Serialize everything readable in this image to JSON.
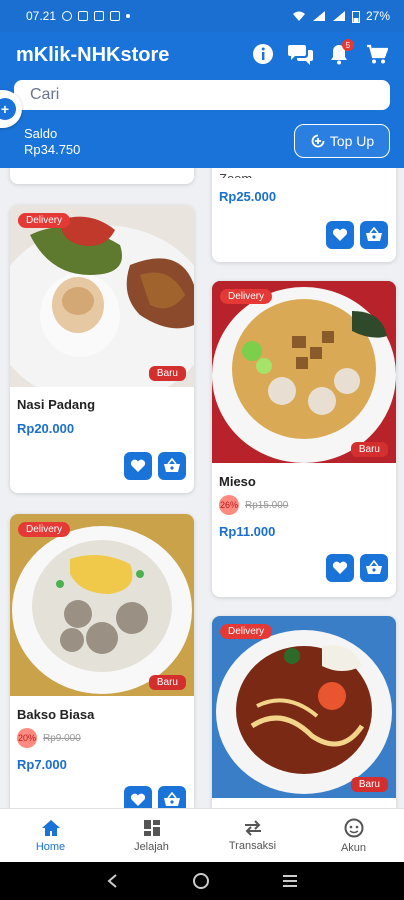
{
  "status_bar": {
    "time": "07.21",
    "battery": "27%"
  },
  "header": {
    "app_title": "mKlik-NHKstore",
    "notification_badge": "5",
    "search_placeholder": "Cari",
    "saldo_label": "Saldo",
    "saldo_value": "Rp34.750",
    "topup_label": "Top Up"
  },
  "products": [
    {
      "name": "Nasi Padang",
      "price": "Rp20.000",
      "delivery": "Delivery",
      "baru": "Baru"
    },
    {
      "name": "Zoom",
      "price": "Rp25.000"
    },
    {
      "name": "Mieso",
      "price": "Rp11.000",
      "discount": "26%",
      "old_price": "Rp15.000",
      "delivery": "Delivery",
      "baru": "Baru"
    },
    {
      "name": "Bakso Biasa",
      "price": "Rp7.000",
      "discount": "20%",
      "old_price": "Rp9.000",
      "delivery": "Delivery",
      "baru": "Baru"
    },
    {
      "delivery": "Delivery",
      "baru": "Baru"
    }
  ],
  "bottom_nav": [
    {
      "label": "Home",
      "active": true
    },
    {
      "label": "Jelajah"
    },
    {
      "label": "Transaksi"
    },
    {
      "label": "Akun"
    }
  ],
  "colors": {
    "primary": "#1a73d9",
    "badge_red": "#e53935",
    "price_blue": "#1a6fd0"
  }
}
